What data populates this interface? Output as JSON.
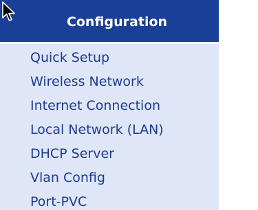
{
  "header": {
    "title": "Configuration",
    "background_color": "#1a3f96",
    "text_color": "#ffffff"
  },
  "cursor": {
    "icon": "mouse-pointer-icon"
  },
  "menu": {
    "background_color": "#dfe6f7",
    "link_color": "#1f3c8d",
    "items": [
      {
        "label": "Quick Setup"
      },
      {
        "label": "Wireless Network"
      },
      {
        "label": "Internet Connection"
      },
      {
        "label": "Local Network (LAN)"
      },
      {
        "label": "DHCP Server"
      },
      {
        "label": "Vlan Config"
      },
      {
        "label": "Port-PVC"
      }
    ]
  }
}
